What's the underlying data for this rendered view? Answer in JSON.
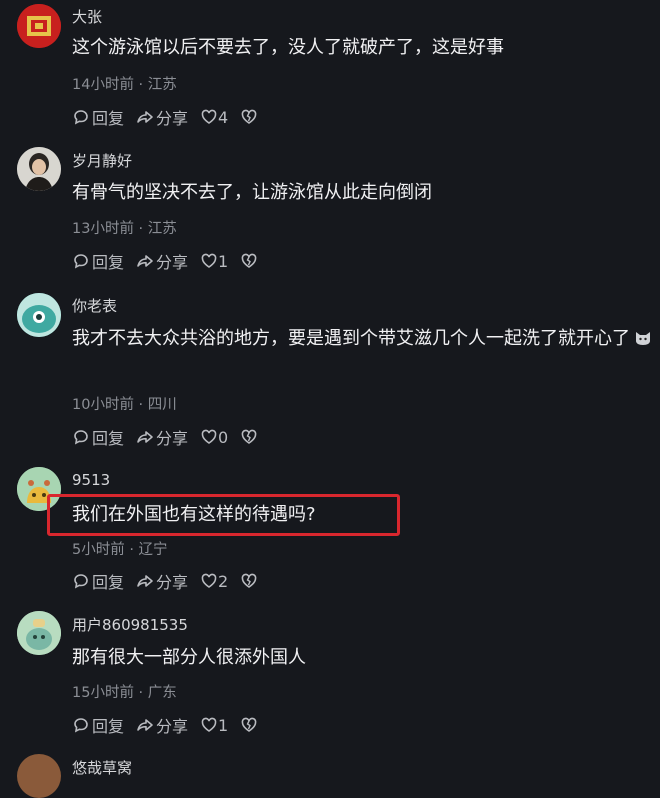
{
  "comments": [
    {
      "username": "大张",
      "text": "这个游泳馆以后不要去了，没人了就破产了，这是好事",
      "meta": "14小时前 · 江苏",
      "reply_label": "回复",
      "share_label": "分享",
      "likes": "4",
      "avatar_icon": "red-character-avatar",
      "avatar_color": "#c8201e"
    },
    {
      "username": "岁月静好",
      "text": "有骨气的坚决不去了，让游泳馆从此走向倒闭",
      "meta": "13小时前 · 江苏",
      "reply_label": "回复",
      "share_label": "分享",
      "likes": "1",
      "avatar_icon": "person-photo-avatar",
      "avatar_color": "#8c8a86"
    },
    {
      "username": "你老表",
      "text": "我才不去大众共浴的地方，要是遇到个带艾滋几个人一起洗了就开心了",
      "meta": "10小时前 · 四川",
      "reply_label": "回复",
      "share_label": "分享",
      "likes": "0",
      "avatar_icon": "teal-creature-avatar",
      "avatar_color": "#3fa9a1"
    },
    {
      "username": "9513",
      "text": "我们在外国也有这样的待遇吗?",
      "meta": "5小时前 · 辽宁",
      "reply_label": "回复",
      "share_label": "分享",
      "likes": "2",
      "avatar_icon": "green-cartoon-avatar",
      "avatar_color": "#a8d5b2"
    },
    {
      "username": "用户860981535",
      "text": "那有很大一部分人很添外国人",
      "meta": "15小时前 · 广东",
      "reply_label": "回复",
      "share_label": "分享",
      "likes": "1",
      "avatar_icon": "green-cartoon-avatar",
      "avatar_color": "#9fcfae"
    }
  ],
  "partial_next_username": "悠哉草窝",
  "colors": {
    "background": "#16181d",
    "highlight_border": "#d9272e",
    "meta_text": "#8b8e95"
  }
}
